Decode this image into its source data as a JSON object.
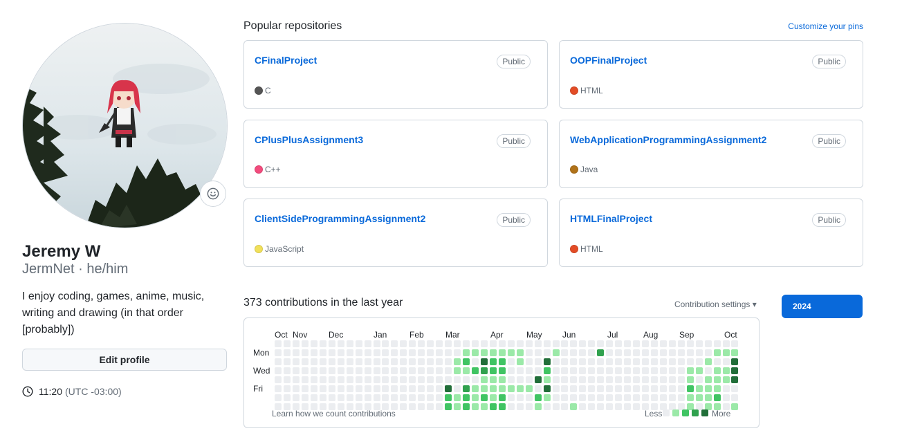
{
  "profile": {
    "display_name": "Jeremy W",
    "username": "JermNet",
    "pronouns": "he/him",
    "sub_line": "JermNet · he/him",
    "bio": "I enjoy coding, games, anime, music, writing and drawing (in that order [probably])",
    "edit_button": "Edit profile",
    "local_time": "11:20",
    "timezone": "(UTC -03:00)",
    "status_icon": "smiley-icon"
  },
  "pinned": {
    "title": "Popular repositories",
    "customize_link": "Customize your pins",
    "repos": [
      {
        "name": "CFinalProject",
        "visibility": "Public",
        "language": "C",
        "lang_color": "#555555"
      },
      {
        "name": "OOPFinalProject",
        "visibility": "Public",
        "language": "HTML",
        "lang_color": "#e34c26"
      },
      {
        "name": "CPlusPlusAssignment3",
        "visibility": "Public",
        "language": "C++",
        "lang_color": "#f34b7d"
      },
      {
        "name": "WebApplicationProgrammingAssignment2",
        "visibility": "Public",
        "language": "Java",
        "lang_color": "#b07219"
      },
      {
        "name": "ClientSideProgrammingAssignment2",
        "visibility": "Public",
        "language": "JavaScript",
        "lang_color": "#f1e05a"
      },
      {
        "name": "HTMLFinalProject",
        "visibility": "Public",
        "language": "HTML",
        "lang_color": "#e34c26"
      }
    ]
  },
  "contributions": {
    "summary": "373 contributions in the last year",
    "settings_label": "Contribution settings ▾",
    "year_button": "2024",
    "months": [
      "Oct",
      "Nov",
      "Dec",
      "Jan",
      "Feb",
      "Mar",
      "Apr",
      "May",
      "Jun",
      "Jul",
      "Aug",
      "Sep",
      "Oct"
    ],
    "day_labels": [
      "Mon",
      "Wed",
      "Fri"
    ],
    "learn_link": "Learn how we count contributions",
    "legend_less": "Less",
    "legend_more": "More",
    "level_colors": [
      "#ebedf0",
      "#9be9a8",
      "#40c463",
      "#30a14e",
      "#216e39"
    ],
    "grid": [
      "0000000000000000000000000000000000000000000000000000",
      "0000000000000000000001111111000100003000000000000111",
      "0000000000000000000012042201004000000000000000001004",
      "0000000000000000000011232200002000000000000000110114",
      "0000000000000000000000011100041000000000000000101114",
      "0000000000000000000403111111104000000000000000211100",
      "0000000000000000000212121200021000000000000000111200",
      "0000000000000000000212112200010001000000000000101101"
    ]
  }
}
